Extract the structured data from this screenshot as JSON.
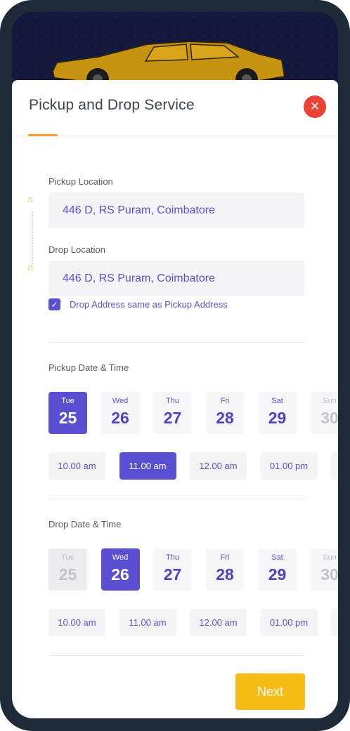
{
  "header": {
    "title": "Pickup and Drop Service",
    "close_glyph": "✕"
  },
  "pickup": {
    "label": "Pickup Location",
    "value": "446 D, RS Puram, Coimbatore",
    "icon": "home-icon"
  },
  "drop": {
    "label": "Drop Location",
    "value": "446 D, RS Puram, Coimbatore",
    "icon": "home-icon"
  },
  "same_address": {
    "label": "Drop Address same as Pickup Address",
    "checked": true
  },
  "pickup_datetime": {
    "label": "Pickup Date & Time",
    "days": [
      {
        "day": "Tue",
        "date": "25",
        "state": "selected"
      },
      {
        "day": "Wed",
        "date": "26",
        "state": "normal"
      },
      {
        "day": "Thu",
        "date": "27",
        "state": "normal"
      },
      {
        "day": "Fri",
        "date": "28",
        "state": "normal"
      },
      {
        "day": "Sat",
        "date": "29",
        "state": "normal"
      },
      {
        "day": "Sun",
        "date": "30",
        "state": "faded"
      }
    ],
    "times": [
      {
        "label": "10.00 am",
        "state": "normal"
      },
      {
        "label": "11.00 am",
        "state": "selected"
      },
      {
        "label": "12.00 am",
        "state": "normal"
      },
      {
        "label": "01.00 pm",
        "state": "normal"
      }
    ]
  },
  "drop_datetime": {
    "label": "Drop Date & Time",
    "days": [
      {
        "day": "Tue",
        "date": "25",
        "state": "disabled"
      },
      {
        "day": "Wed",
        "date": "26",
        "state": "selected"
      },
      {
        "day": "Thu",
        "date": "27",
        "state": "normal"
      },
      {
        "day": "Fri",
        "date": "28",
        "state": "normal"
      },
      {
        "day": "Sat",
        "date": "29",
        "state": "normal"
      },
      {
        "day": "Sun",
        "date": "30",
        "state": "faded"
      }
    ],
    "times": [
      {
        "label": "10.00 am",
        "state": "normal"
      },
      {
        "label": "11.00 am",
        "state": "normal"
      },
      {
        "label": "12.00 am",
        "state": "normal"
      },
      {
        "label": "01.00 pm",
        "state": "normal"
      }
    ]
  },
  "next_label": "Next",
  "colors": {
    "accent": "#5b4fd1",
    "close": "#ea4335",
    "next": "#f6bb14",
    "tab_underline": "#f39a2a",
    "pin": "#f3b416"
  }
}
